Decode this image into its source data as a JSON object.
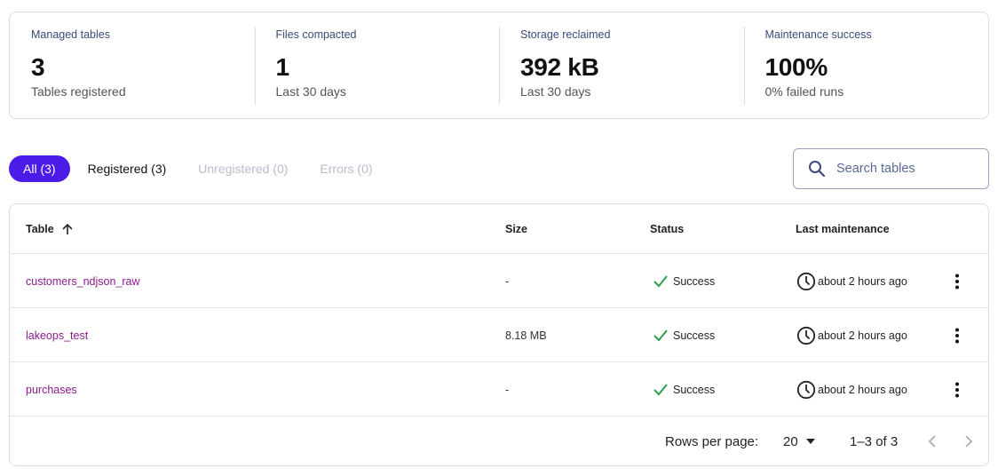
{
  "stats": [
    {
      "label": "Managed tables",
      "value": "3",
      "sub": "Tables registered"
    },
    {
      "label": "Files compacted",
      "value": "1",
      "sub": "Last 30 days"
    },
    {
      "label": "Storage reclaimed",
      "value": "392 kB",
      "sub": "Last 30 days"
    },
    {
      "label": "Maintenance success",
      "value": "100%",
      "sub": "0% failed runs"
    }
  ],
  "filters": [
    {
      "label": "All (3)",
      "state": "active"
    },
    {
      "label": "Registered (3)",
      "state": "normal"
    },
    {
      "label": "Unregistered (0)",
      "state": "muted"
    },
    {
      "label": "Errors (0)",
      "state": "muted"
    }
  ],
  "search": {
    "placeholder": "Search tables",
    "icon": "search-icon"
  },
  "table": {
    "columns": {
      "table": "Table",
      "size": "Size",
      "status": "Status",
      "last": "Last maintenance"
    },
    "sort": {
      "column": "Table",
      "direction": "ascending",
      "icon": "arrow-up-icon"
    },
    "rows": [
      {
        "name": "customers_ndjson_raw",
        "size": "-",
        "status": "Success",
        "last": "about 2 hours ago"
      },
      {
        "name": "lakeops_test",
        "size": "8.18 MB",
        "status": "Success",
        "last": "about 2 hours ago"
      },
      {
        "name": "purchases",
        "size": "-",
        "status": "Success",
        "last": "about 2 hours ago"
      }
    ]
  },
  "pagination": {
    "rows_per_page_label": "Rows per page:",
    "rows_per_page": "20",
    "range": "1–3 of 3"
  },
  "colors": {
    "accent": "#4b1be8",
    "link": "#8b1a8f",
    "success": "#2e9e4a",
    "stat_label": "#3b4a7a"
  }
}
